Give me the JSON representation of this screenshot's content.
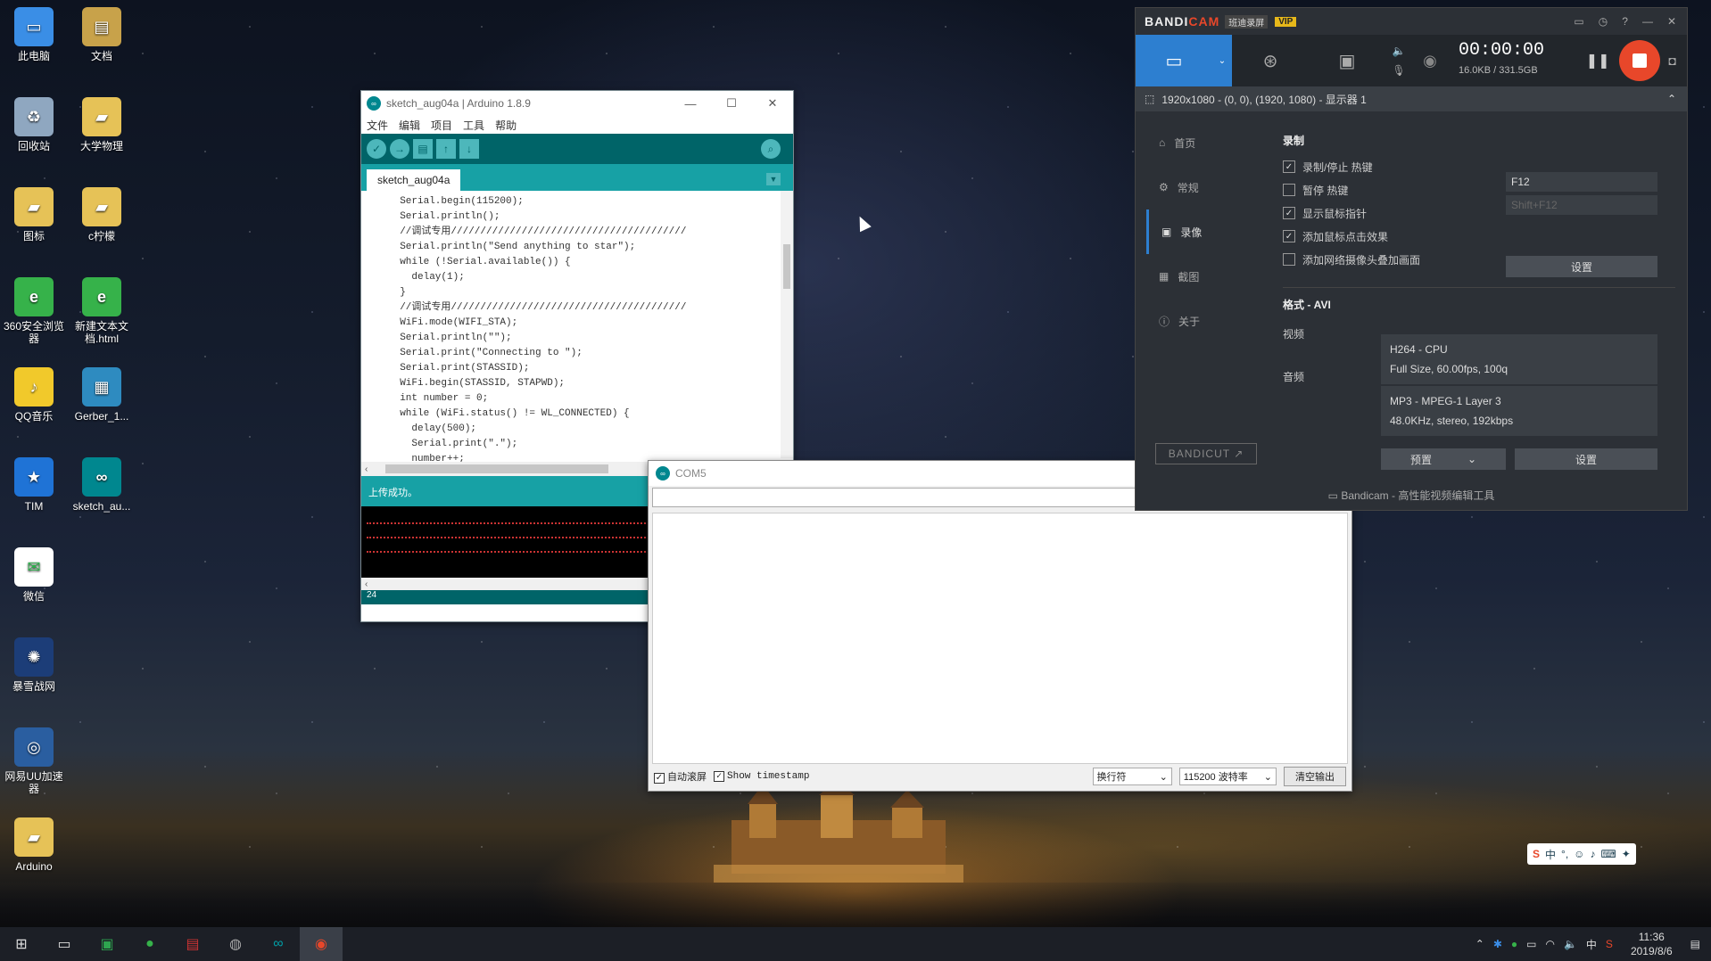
{
  "desktop": {
    "icons": [
      {
        "label": "此电脑",
        "icon": "computer-icon",
        "color": "#3a8ee6"
      },
      {
        "label": "文档",
        "icon": "document-icon",
        "color": "#c8a24a"
      },
      {
        "label": "回收站",
        "icon": "recycle-bin-icon",
        "color": "#8fa7c0"
      },
      {
        "label": "大学物理",
        "icon": "folder-icon",
        "color": "#e6c257"
      },
      {
        "label": "图标",
        "icon": "folder-icon",
        "color": "#e6c257"
      },
      {
        "label": "c柠檬",
        "icon": "folder-icon",
        "color": "#e6c257"
      },
      {
        "label": "360安全浏览器",
        "icon": "browser-icon",
        "color": "#36b24a"
      },
      {
        "label": "新建文本文档.html",
        "icon": "html-file-icon",
        "color": "#36b24a"
      },
      {
        "label": "QQ音乐",
        "icon": "music-icon",
        "color": "#f1c92b"
      },
      {
        "label": "Gerber_1...",
        "icon": "archive-icon",
        "color": "#2e8bc0"
      },
      {
        "label": "TIM",
        "icon": "tim-icon",
        "color": "#1f73d6"
      },
      {
        "label": "sketch_au...",
        "icon": "arduino-file-icon",
        "color": "#00878f"
      },
      {
        "label": "微信",
        "icon": "wechat-icon",
        "color": "#ffffff"
      },
      {
        "label": "暴雪战网",
        "icon": "battlenet-icon",
        "color": "#1c3d78"
      },
      {
        "label": "网易UU加速器",
        "icon": "accelerator-icon",
        "color": "#2a5ea0"
      },
      {
        "label": "Arduino",
        "icon": "folder-icon",
        "color": "#e6c257"
      }
    ]
  },
  "arduino": {
    "title": "sketch_aug04a | Arduino 1.8.9",
    "menu": [
      "文件",
      "编辑",
      "项目",
      "工具",
      "帮助"
    ],
    "tab": "sketch_aug04a",
    "code": "  Serial.begin(115200);\n  Serial.println();\n  //调试专用////////////////////////////////////////\n  Serial.println(\"Send anything to star\");\n  while (!Serial.available()) {\n    delay(1);\n  }\n  //调试专用////////////////////////////////////////\n  WiFi.mode(WIFI_STA);\n  Serial.println(\"\");\n  Serial.print(\"Connecting to \");\n  Serial.print(STASSID);\n  WiFi.begin(STASSID, STAPWD);\n  int number = 0;\n  while (WiFi.status() != WL_CONNECTED) {\n    delay(500);\n    Serial.print(\".\");\n    number++;",
    "status": "上传成功。",
    "line_number": "24"
  },
  "serial_monitor": {
    "title": "COM5",
    "input_value": "",
    "autoscroll_label": "自动滚屏",
    "timestamp_label": "Show timestamp",
    "line_ending": "换行符",
    "baud": "115200 波特率",
    "clear_label": "清空输出"
  },
  "bandicam": {
    "brand_a": "BANDI",
    "brand_b": "CAM",
    "subtitle": "班迪录屏",
    "vip": "VIP",
    "timer": "00:00:00",
    "size": "16.0KB / 331.5GB",
    "region": "1920x1080 - (0, 0), (1920, 1080) - 显示器 1",
    "nav": [
      "首页",
      "常规",
      "录像",
      "截图",
      "关于"
    ],
    "record_section": "录制",
    "options": [
      {
        "label": "录制/停止 热键",
        "checked": true
      },
      {
        "label": "暂停 热键",
        "checked": false
      },
      {
        "label": "显示鼠标指针",
        "checked": true
      },
      {
        "label": "添加鼠标点击效果",
        "checked": true
      },
      {
        "label": "添加网络摄像头叠加画面",
        "checked": false
      }
    ],
    "hotkey_record": "F12",
    "hotkey_pause": "Shift+F12",
    "settings_label": "设置",
    "format_section": "格式 - AVI",
    "video_label": "视频",
    "video_codec": "H264 - CPU",
    "video_detail": "Full Size, 60.00fps, 100q",
    "audio_label": "音频",
    "audio_codec": "MP3 - MPEG-1 Layer 3",
    "audio_detail": "48.0KHz, stereo, 192kbps",
    "preset_label": "预置",
    "bandicut": "BANDICUT ↗",
    "footer": "Bandicam - 高性能视频编辑工具"
  },
  "taskbar": {
    "time": "11:36",
    "date": "2019/8/6",
    "ime": "中"
  }
}
